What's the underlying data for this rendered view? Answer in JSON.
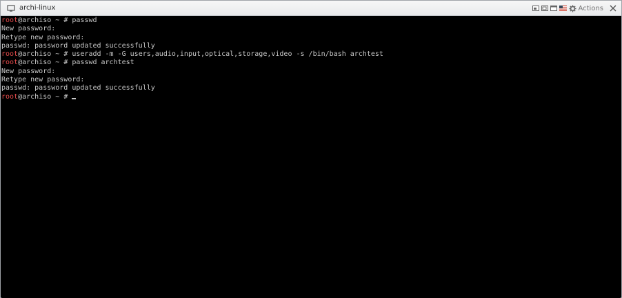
{
  "window": {
    "title": "archi-linux",
    "actions_label": "Actions"
  },
  "icons": {
    "vm": "monitor-icon",
    "view_1": "window-scale-icon",
    "view_2": "window-fit-icon",
    "view_3": "window-maximize-icon",
    "keyboard": "us-flag-icon",
    "actions": "gear-icon",
    "close": "close-icon"
  },
  "colors": {
    "prompt_user": "#e24b4b",
    "terminal_text": "#c8c8c8",
    "terminal_bg": "#000000"
  },
  "terminal": {
    "lines": [
      {
        "type": "prompt",
        "user": "root",
        "host": "@archiso ~ # ",
        "cmd": "passwd"
      },
      {
        "type": "output",
        "text": "New password:"
      },
      {
        "type": "output",
        "text": "Retype new password:"
      },
      {
        "type": "output",
        "text": "passwd: password updated successfully"
      },
      {
        "type": "prompt",
        "user": "root",
        "host": "@archiso ~ # ",
        "cmd": "useradd -m -G users,audio,input,optical,storage,video -s /bin/bash archtest"
      },
      {
        "type": "prompt",
        "user": "root",
        "host": "@archiso ~ # ",
        "cmd": "passwd archtest"
      },
      {
        "type": "output",
        "text": "New password:"
      },
      {
        "type": "output",
        "text": "Retype new password:"
      },
      {
        "type": "output",
        "text": "passwd: password updated successfully"
      },
      {
        "type": "prompt",
        "user": "root",
        "host": "@archiso ~ # ",
        "cmd": ""
      }
    ]
  }
}
